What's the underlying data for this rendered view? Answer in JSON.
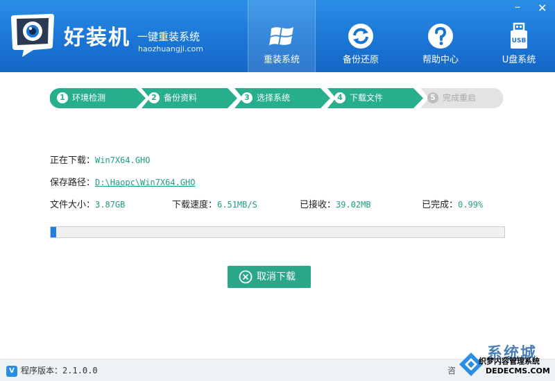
{
  "app": {
    "brand": "好装机",
    "slogan": "一键重装系统",
    "domain": "haozhuangji.com"
  },
  "window_controls": {
    "minimize": "–",
    "close": "✕"
  },
  "nav": [
    {
      "label": "重装系统",
      "icon": "windows-logo-icon",
      "active": true
    },
    {
      "label": "备份还原",
      "icon": "refresh-icon",
      "active": false
    },
    {
      "label": "帮助中心",
      "icon": "help-icon",
      "active": false
    },
    {
      "label": "U盘系统",
      "icon": "usb-icon",
      "active": false
    }
  ],
  "steps": [
    {
      "num": "1",
      "label": "环境检测",
      "done": true
    },
    {
      "num": "2",
      "label": "备份资料",
      "done": true
    },
    {
      "num": "3",
      "label": "选择系统",
      "done": true
    },
    {
      "num": "4",
      "label": "下载文件",
      "done": true
    },
    {
      "num": "5",
      "label": "完成重启",
      "done": false
    }
  ],
  "download": {
    "downloading_label": "正在下载：",
    "downloading_value": "Win7X64.GHO",
    "path_label": "保存路径：",
    "path_value": "D:\\Haopc\\Win7X64.GHO",
    "size_label": "文件大小：",
    "size_value": "3.87GB",
    "speed_label": "下载速度：",
    "speed_value": "6.51MB/S",
    "received_label": "已接收：",
    "received_value": "39.02MB",
    "completed_label": "已完成：",
    "completed_value": "0.99%",
    "progress_percent": 0.99
  },
  "cancel_button": {
    "label": "取消下载"
  },
  "footer": {
    "version_badge": "V",
    "version_label": "程序版本：",
    "version_value": "2.1.0.0",
    "consult": "咨"
  },
  "watermark": {
    "big": "系统城",
    "small": "织梦内容管理系统",
    "url": "DEDECMS.COM"
  },
  "colors": {
    "header": "#1a74d4",
    "step_active": "#27ae8c",
    "step_inactive": "#e3e3e3",
    "value_text": "#1f9d87",
    "progress": "#1e7fe0"
  }
}
